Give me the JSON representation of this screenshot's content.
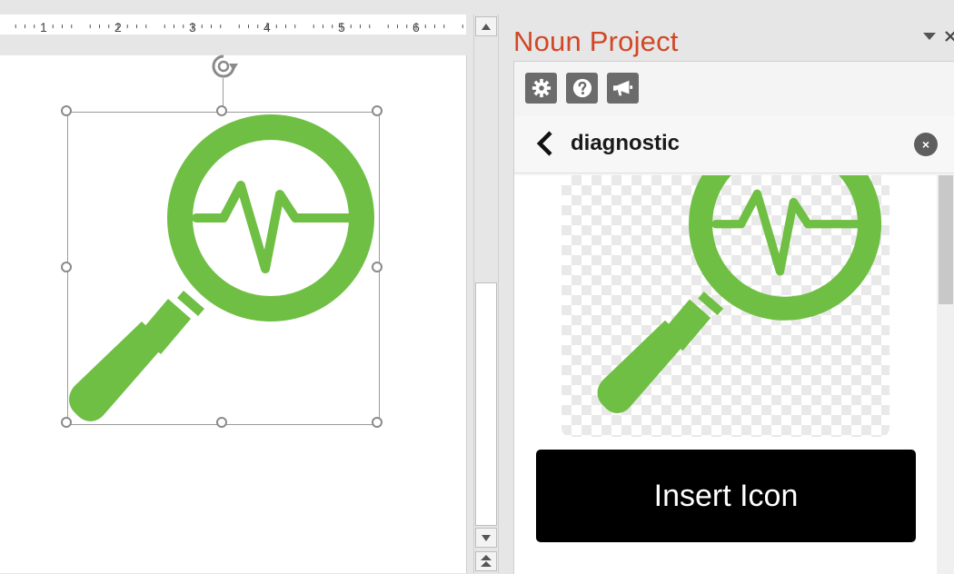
{
  "ruler": {
    "labels": [
      "1",
      "2",
      "3",
      "4",
      "5",
      "6"
    ]
  },
  "pane": {
    "title": "Noun Project",
    "options_icon": "chevron-down-icon",
    "close_icon": "close-icon",
    "toolbar": [
      {
        "name": "settings-button",
        "icon": "gear-icon"
      },
      {
        "name": "help-button",
        "icon": "question-icon"
      },
      {
        "name": "announce-button",
        "icon": "megaphone-icon"
      }
    ],
    "search": {
      "term": "diagnostic",
      "back_icon": "chevron-left-icon",
      "clear_label": "×"
    },
    "insert_label": "Insert Icon"
  },
  "colors": {
    "icon_green": "#6fbf44",
    "pane_title": "#d24726",
    "toolbar_button": "#6b6b6b"
  }
}
